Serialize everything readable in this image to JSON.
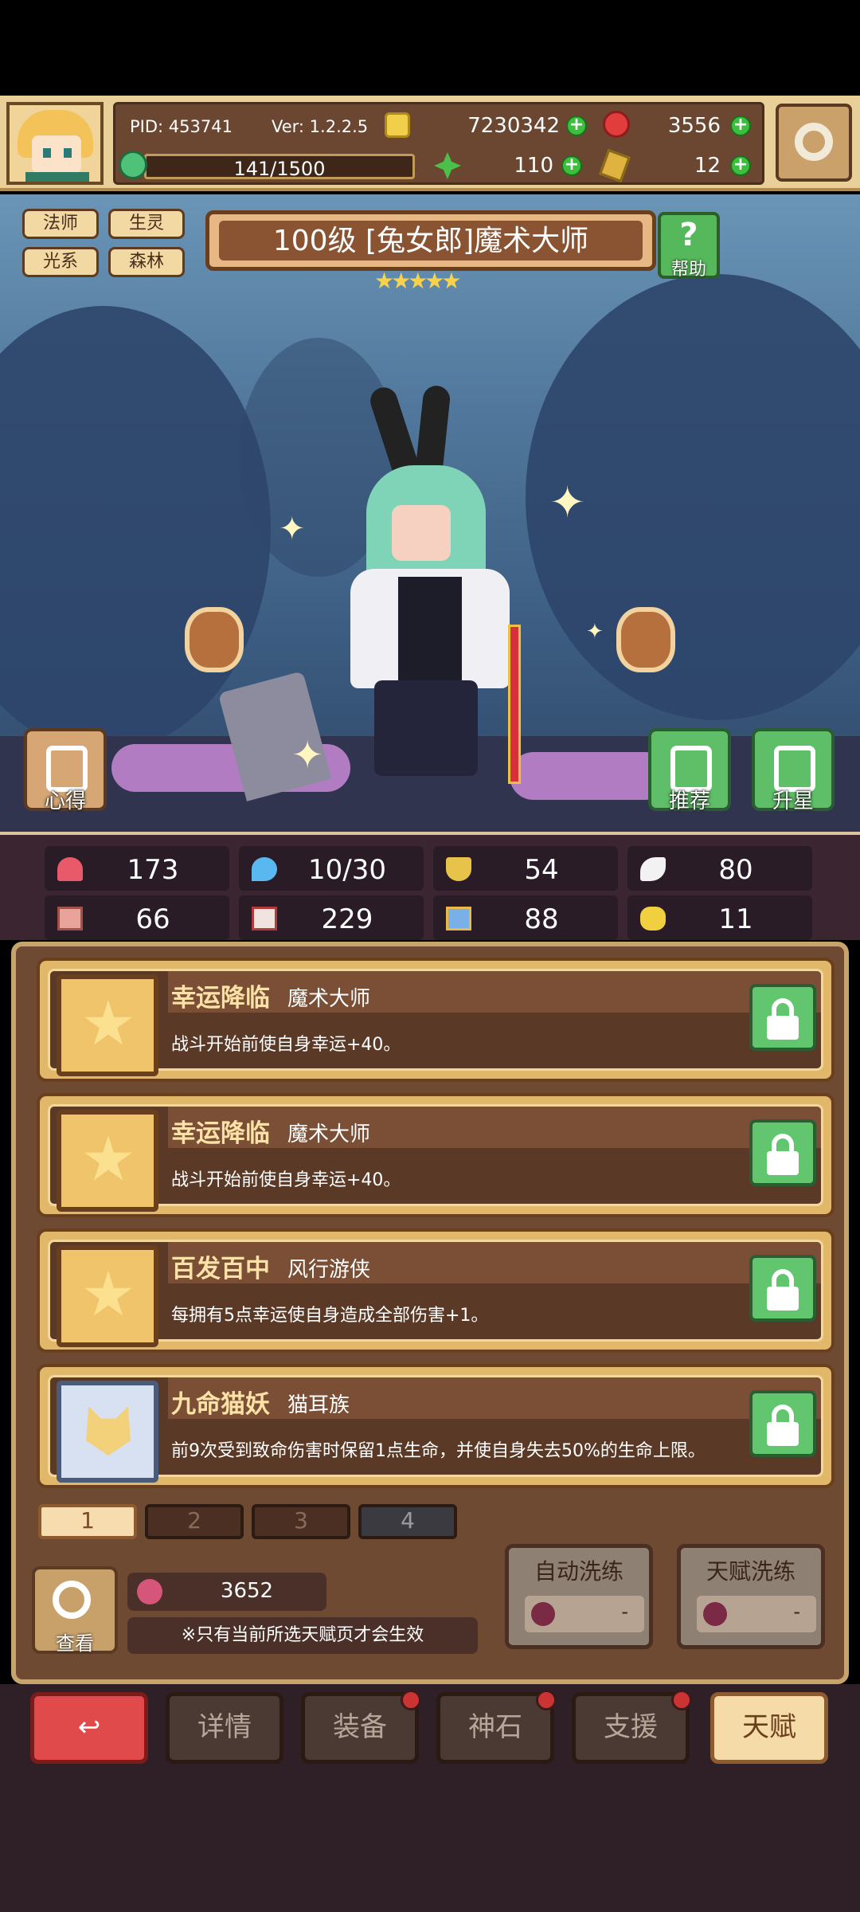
{
  "header": {
    "pid": "PID: 453741",
    "version": "Ver: 1.2.2.5",
    "gold": "7230342",
    "gems": "3556",
    "stamina": "141/1500",
    "clover": "110",
    "keys": "12"
  },
  "hero": {
    "tags": [
      "法师",
      "生灵",
      "光系",
      "森林"
    ],
    "title": "100级 [兔女郎]魔术大师",
    "stars": "★★★★★",
    "help_label": "帮助",
    "left_button": "心得",
    "recommend_button": "推荐",
    "star_up_button": "升星"
  },
  "stats": {
    "hp": "173",
    "energy": "10/30",
    "defense": "54",
    "speed": "80",
    "attack": "66",
    "magic": "229",
    "resist": "88",
    "luck": "11"
  },
  "talents": [
    {
      "name": "幸运降临",
      "source": "魔术大师",
      "desc": "战斗开始前使自身幸运+40。"
    },
    {
      "name": "幸运降临",
      "source": "魔术大师",
      "desc": "战斗开始前使自身幸运+40。"
    },
    {
      "name": "百发百中",
      "source": "风行游侠",
      "desc": "每拥有5点幸运使自身造成全部伤害+1。"
    },
    {
      "name": "九命猫妖",
      "source": "猫耳族",
      "desc": "前9次受到致命伤害时保留1点生命，并使自身失去50%的生命上限。"
    }
  ],
  "pages": [
    "1",
    "2",
    "3",
    "4"
  ],
  "footer": {
    "view_label": "查看",
    "points": "3652",
    "note": "※只有当前所选天赋页才会生效",
    "auto_wash": "自动洗练",
    "talent_wash": "天赋洗练",
    "auto_wash_cost": "-",
    "talent_wash_cost": "-"
  },
  "nav": {
    "back_icon": "return-arrow",
    "details": "详情",
    "equipment": "装备",
    "godstone": "神石",
    "support": "支援",
    "talent": "天赋"
  }
}
